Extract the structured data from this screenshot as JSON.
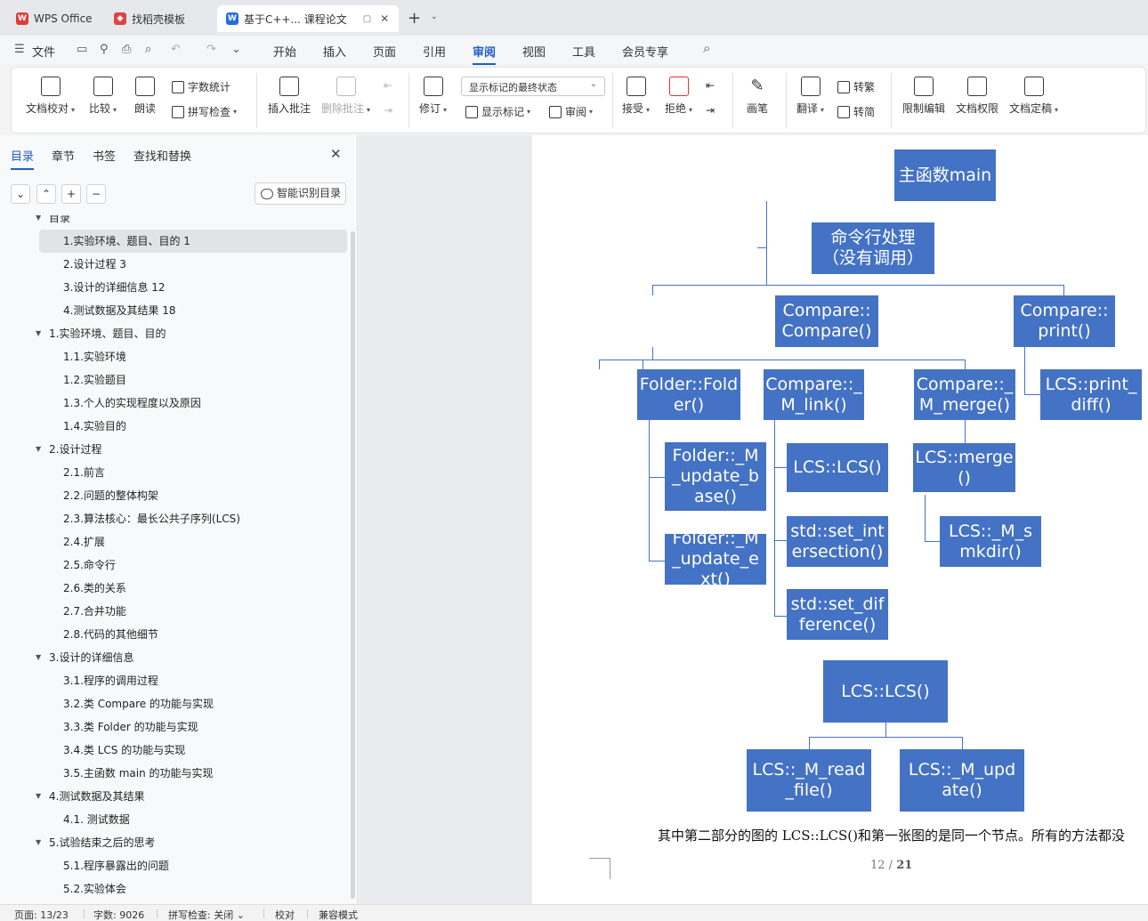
{
  "titlebar": {
    "tabs": [
      {
        "label": "WPS Office",
        "icon": "wps-logo-icon",
        "color": "#e03d36"
      },
      {
        "label": "找稻壳模板",
        "icon": "docer-icon",
        "color": "#e04545"
      },
      {
        "label": "基于C++... 课程论文",
        "icon": "word-doc-icon",
        "color": "#2b6cd8"
      }
    ],
    "new_tab": "+",
    "tab_close": "✕"
  },
  "menu": {
    "file": "文件",
    "items": [
      "开始",
      "插入",
      "页面",
      "引用",
      "审阅",
      "视图",
      "工具",
      "会员专享"
    ],
    "active": "审阅"
  },
  "ribbon": {
    "doc_check": "文档校对",
    "compare": "比较",
    "read_aloud": "朗读",
    "word_count": "字数统计",
    "spell_check": "拼写检查",
    "insert_comment": "插入批注",
    "delete_comment": "删除批注",
    "track_changes": "修订",
    "markup_state": "显示标记的最终状态",
    "show_markup": "显示标记",
    "review": "审阅",
    "accept": "接受",
    "reject": "拒绝",
    "pen": "画笔",
    "translate": "翻译",
    "to_traditional": "转繁",
    "to_simplified": "转简",
    "restrict_edit": "限制编辑",
    "doc_permission": "文档权限",
    "finalize": "文档定稿"
  },
  "nav": {
    "tabs": [
      "目录",
      "章节",
      "书签",
      "查找和替换"
    ],
    "active_tab": "目录",
    "smart_toc": "智能识别目录",
    "toc": [
      {
        "label": "目录",
        "level": 0,
        "arrow": true
      },
      {
        "label": "1.实验环境、题目、目的 1",
        "level": 1,
        "selected": true
      },
      {
        "label": "2.设计过程 3",
        "level": 1
      },
      {
        "label": "3.设计的详细信息 12",
        "level": 1
      },
      {
        "label": "4.测试数据及其结果 18",
        "level": 1
      },
      {
        "label": "1.实验环境、题目、目的",
        "level": 0,
        "arrow": true
      },
      {
        "label": "1.1.实验环境",
        "level": 1
      },
      {
        "label": "1.2.实验题目",
        "level": 1
      },
      {
        "label": "1.3.个人的实现程度以及原因",
        "level": 1
      },
      {
        "label": "1.4.实验目的",
        "level": 1
      },
      {
        "label": "2.设计过程",
        "level": 0,
        "arrow": true
      },
      {
        "label": "2.1.前言",
        "level": 1
      },
      {
        "label": "2.2.问题的整体构架",
        "level": 1
      },
      {
        "label": "2.3.算法核心：最长公共子序列(LCS)",
        "level": 1
      },
      {
        "label": "2.4.扩展",
        "level": 1
      },
      {
        "label": "2.5.命令行",
        "level": 1
      },
      {
        "label": "2.6.类的关系",
        "level": 1
      },
      {
        "label": "2.7.合并功能",
        "level": 1
      },
      {
        "label": "2.8.代码的其他细节",
        "level": 1
      },
      {
        "label": "3.设计的详细信息",
        "level": 0,
        "arrow": true
      },
      {
        "label": "3.1.程序的调用过程",
        "level": 1
      },
      {
        "label": "3.2.类 Compare 的功能与实现",
        "level": 1
      },
      {
        "label": "3.3.类 Folder 的功能与实现",
        "level": 1
      },
      {
        "label": "3.4.类 LCS 的功能与实现",
        "level": 1
      },
      {
        "label": "3.5.主函数 main 的功能与实现",
        "level": 1
      },
      {
        "label": "4.测试数据及其结果",
        "level": 0,
        "arrow": true
      },
      {
        "label": "4.1. 测试数据",
        "level": 1
      },
      {
        "label": "5.试验结束之后的思考",
        "level": 0,
        "arrow": true
      },
      {
        "label": "5.1.程序暴露出的问题",
        "level": 1
      },
      {
        "label": "5.2.实验体会",
        "level": 1
      }
    ]
  },
  "diagram": {
    "main": "主函数main",
    "cmdline": "命令行处理（没有调用）",
    "compare_ctor": "Compare::Compare()",
    "compare_print": "Compare::print()",
    "folder_ctor": "Folder::Folder()",
    "compare_link": "Compare::_M_link()",
    "compare_merge": "Compare::_M_merge()",
    "lcs_print_diff": "LCS::print_diff()",
    "folder_update_base": "Folder::_M_update_base()",
    "folder_update_ext": "Folder::_M_update_ext()",
    "lcs_ctor": "LCS::LCS()",
    "set_intersection": "std::set_intersection()",
    "set_difference": "std::set_difference()",
    "lcs_merge": "LCS::merge()",
    "lcs_smkdir": "LCS::_M_smkdir()",
    "lcs_ctor2": "LCS::LCS()",
    "lcs_read_file": "LCS::_M_read_file()",
    "lcs_update": "LCS::_M_update()",
    "node_color": "#4472c4"
  },
  "document": {
    "caption": "其中第二部分的图的 LCS::LCS()和第一张图的是同一个节点。所有的方法都没",
    "page_current": "12",
    "page_total": "21"
  },
  "status": {
    "page": "页面: 13/23",
    "words": "字数: 9026",
    "spell": "拼写检查: 关闭",
    "proof": "校对",
    "compat": "兼容模式"
  }
}
